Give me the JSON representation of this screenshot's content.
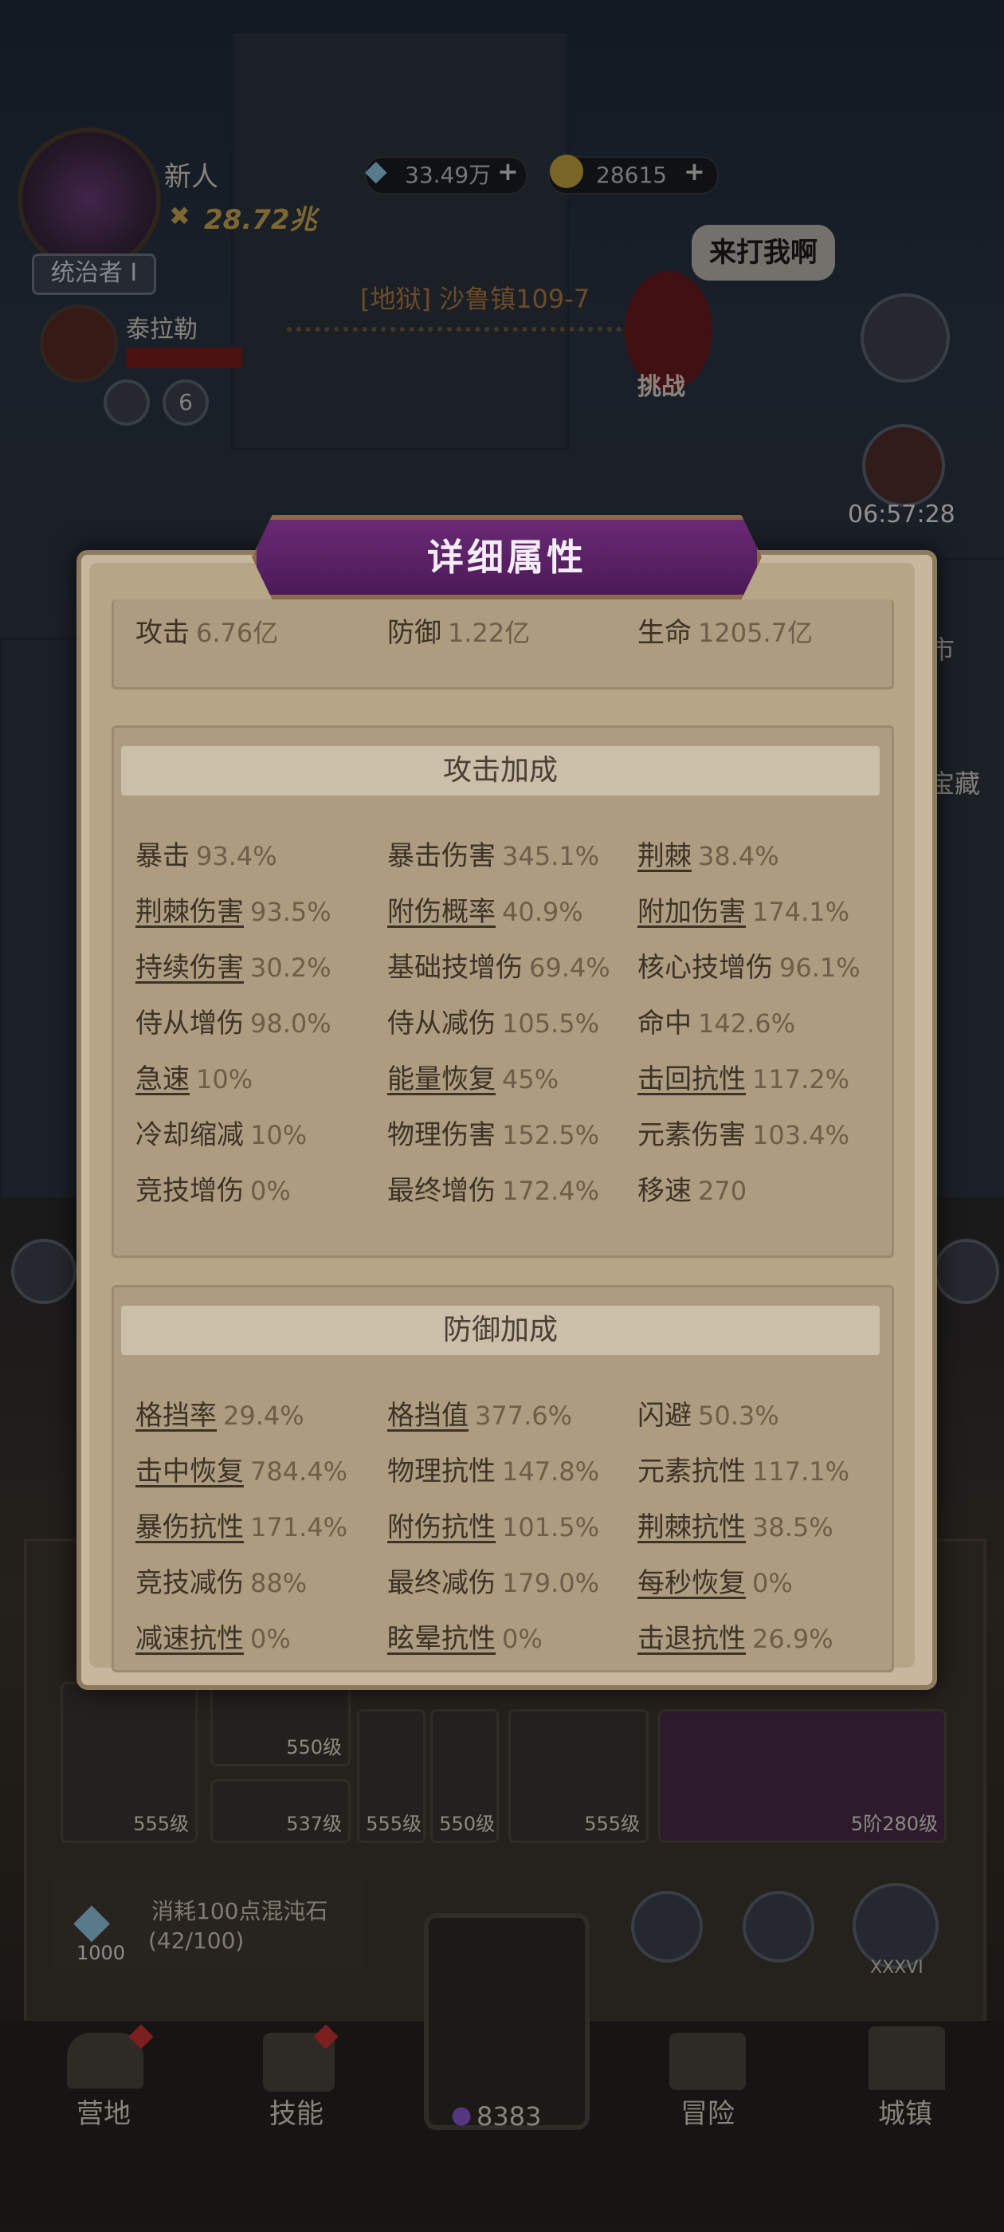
{
  "hud": {
    "player_name": "新人",
    "power": "28.72兆",
    "rank": "统治者 I",
    "companion_name": "泰拉勒",
    "companion_level": "6",
    "crystals": "33.49万",
    "coins": "28615"
  },
  "stage": {
    "title": "[地狱] 沙鲁镇109-7",
    "challenge_label": "挑战",
    "speech": "来打我啊"
  },
  "timer": "06:57:28",
  "side_labels": {
    "market": "市",
    "treasure": "宝藏"
  },
  "modal": {
    "title": "详细属性",
    "base_stats": [
      {
        "label": "攻击",
        "value": "6.76亿",
        "underline": false
      },
      {
        "label": "防御",
        "value": "1.22亿",
        "underline": false
      },
      {
        "label": "生命",
        "value": "1205.7亿",
        "underline": false
      }
    ],
    "attack_section": {
      "title": "攻击加成",
      "stats": [
        {
          "label": "暴击",
          "value": "93.4%",
          "underline": false
        },
        {
          "label": "暴击伤害",
          "value": "345.1%",
          "underline": false
        },
        {
          "label": "荆棘",
          "value": "38.4%",
          "underline": true
        },
        {
          "label": "荆棘伤害",
          "value": "93.5%",
          "underline": true
        },
        {
          "label": "附伤概率",
          "value": "40.9%",
          "underline": true
        },
        {
          "label": "附加伤害",
          "value": "174.1%",
          "underline": true
        },
        {
          "label": "持续伤害",
          "value": "30.2%",
          "underline": true
        },
        {
          "label": "基础技增伤",
          "value": "69.4%",
          "underline": false
        },
        {
          "label": "核心技增伤",
          "value": "96.1%",
          "underline": false
        },
        {
          "label": "侍从增伤",
          "value": "98.0%",
          "underline": false
        },
        {
          "label": "侍从减伤",
          "value": "105.5%",
          "underline": false
        },
        {
          "label": "命中",
          "value": "142.6%",
          "underline": false
        },
        {
          "label": "急速",
          "value": "10%",
          "underline": true
        },
        {
          "label": "能量恢复",
          "value": "45%",
          "underline": true
        },
        {
          "label": "击回抗性",
          "value": "117.2%",
          "underline": true
        },
        {
          "label": "冷却缩减",
          "value": "10%",
          "underline": false
        },
        {
          "label": "物理伤害",
          "value": "152.5%",
          "underline": false
        },
        {
          "label": "元素伤害",
          "value": "103.4%",
          "underline": false
        },
        {
          "label": "竞技增伤",
          "value": "0%",
          "underline": false
        },
        {
          "label": "最终增伤",
          "value": "172.4%",
          "underline": false
        },
        {
          "label": "移速",
          "value": "270",
          "underline": false
        }
      ]
    },
    "defense_section": {
      "title": "防御加成",
      "stats": [
        {
          "label": "格挡率",
          "value": "29.4%",
          "underline": true
        },
        {
          "label": "格挡值",
          "value": "377.6%",
          "underline": true
        },
        {
          "label": "闪避",
          "value": "50.3%",
          "underline": false
        },
        {
          "label": "击中恢复",
          "value": "784.4%",
          "underline": true
        },
        {
          "label": "物理抗性",
          "value": "147.8%",
          "underline": false
        },
        {
          "label": "元素抗性",
          "value": "117.1%",
          "underline": false
        },
        {
          "label": "暴伤抗性",
          "value": "171.4%",
          "underline": true
        },
        {
          "label": "附伤抗性",
          "value": "101.5%",
          "underline": true
        },
        {
          "label": "荆棘抗性",
          "value": "38.5%",
          "underline": true
        },
        {
          "label": "竞技减伤",
          "value": "88%",
          "underline": false
        },
        {
          "label": "最终减伤",
          "value": "179.0%",
          "underline": false
        },
        {
          "label": "每秒恢复",
          "value": "0%",
          "underline": true
        },
        {
          "label": "减速抗性",
          "value": "0%",
          "underline": true
        },
        {
          "label": "眩晕抗性",
          "value": "0%",
          "underline": true
        },
        {
          "label": "击退抗性",
          "value": "26.9%",
          "underline": true
        }
      ]
    }
  },
  "equipment": {
    "levels": [
      "555级",
      "550级",
      "537级",
      "555级",
      "550级",
      "555级",
      "5阶280级"
    ]
  },
  "forge": {
    "cost_text": "消耗100点混沌石",
    "progress_text": "(42/100)",
    "stone_count": "1000",
    "rank_roman": "XXXVI"
  },
  "nav": {
    "camp": "营地",
    "skills": "技能",
    "center_count": "8383",
    "adventure": "冒险",
    "town": "城镇"
  }
}
